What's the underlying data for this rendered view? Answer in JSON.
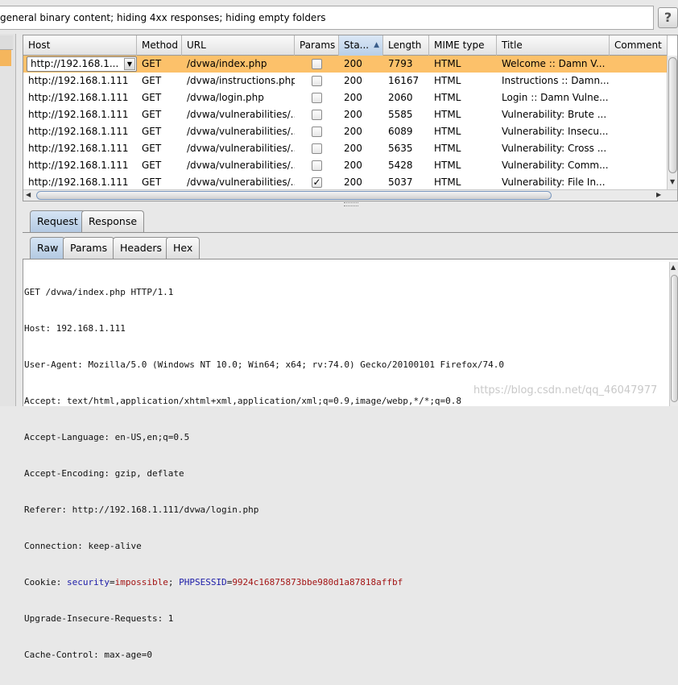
{
  "filter": {
    "text": "general binary content;  hiding 4xx responses;  hiding empty folders",
    "help_label": "?"
  },
  "table": {
    "columns": [
      "Host",
      "Method",
      "URL",
      "Params",
      "Sta...",
      "Length",
      "MIME type",
      "Title",
      "Comment"
    ],
    "sort_indicator": "▲",
    "rows": [
      {
        "host": "http://192.168.1...",
        "method": "GET",
        "url": "/dvwa/index.php",
        "params": false,
        "status": "200",
        "length": "7793",
        "mime": "HTML",
        "title": "Welcome :: Damn V...",
        "comment": "",
        "selected": true
      },
      {
        "host": "http://192.168.1.111",
        "method": "GET",
        "url": "/dvwa/instructions.php",
        "params": false,
        "status": "200",
        "length": "16167",
        "mime": "HTML",
        "title": "Instructions :: Damn...",
        "comment": "",
        "selected": false
      },
      {
        "host": "http://192.168.1.111",
        "method": "GET",
        "url": "/dvwa/login.php",
        "params": false,
        "status": "200",
        "length": "2060",
        "mime": "HTML",
        "title": "Login :: Damn Vulne...",
        "comment": "",
        "selected": false
      },
      {
        "host": "http://192.168.1.111",
        "method": "GET",
        "url": "/dvwa/vulnerabilities/...",
        "params": false,
        "status": "200",
        "length": "5585",
        "mime": "HTML",
        "title": "Vulnerability: Brute ...",
        "comment": "",
        "selected": false
      },
      {
        "host": "http://192.168.1.111",
        "method": "GET",
        "url": "/dvwa/vulnerabilities/...",
        "params": false,
        "status": "200",
        "length": "6089",
        "mime": "HTML",
        "title": "Vulnerability: Insecu...",
        "comment": "",
        "selected": false
      },
      {
        "host": "http://192.168.1.111",
        "method": "GET",
        "url": "/dvwa/vulnerabilities/...",
        "params": false,
        "status": "200",
        "length": "5635",
        "mime": "HTML",
        "title": "Vulnerability: Cross ...",
        "comment": "",
        "selected": false
      },
      {
        "host": "http://192.168.1.111",
        "method": "GET",
        "url": "/dvwa/vulnerabilities/...",
        "params": false,
        "status": "200",
        "length": "5428",
        "mime": "HTML",
        "title": "Vulnerability: Comm...",
        "comment": "",
        "selected": false
      },
      {
        "host": "http://192.168.1.111",
        "method": "GET",
        "url": "/dvwa/vulnerabilities/...",
        "params": true,
        "status": "200",
        "length": "5037",
        "mime": "HTML",
        "title": "Vulnerability: File In...",
        "comment": "",
        "selected": false
      }
    ]
  },
  "message_tabs": {
    "request": "Request",
    "response": "Response",
    "active": "request"
  },
  "view_tabs": {
    "raw": "Raw",
    "params": "Params",
    "headers": "Headers",
    "hex": "Hex",
    "active": "raw"
  },
  "request": {
    "lines": [
      "GET /dvwa/index.php HTTP/1.1",
      "Host: 192.168.1.111",
      "User-Agent: Mozilla/5.0 (Windows NT 10.0; Win64; x64; rv:74.0) Gecko/20100101 Firefox/74.0",
      "Accept: text/html,application/xhtml+xml,application/xml;q=0.9,image/webp,*/*;q=0.8",
      "Accept-Language: en-US,en;q=0.5",
      "Accept-Encoding: gzip, deflate",
      "Referer: http://192.168.1.111/dvwa/login.php",
      "Connection: keep-alive"
    ],
    "cookie_prefix": "Cookie: ",
    "cookies": [
      {
        "name": "security",
        "value": "impossible"
      },
      {
        "name": "PHPSESSID",
        "value": "9924c16875873bbe980d1a87818affbf"
      }
    ],
    "tail_lines": [
      "Upgrade-Insecure-Requests: 1",
      "Cache-Control: max-age=0"
    ]
  },
  "watermark": "https://blog.csdn.net/qq_46047977",
  "colors": {
    "selected_row": "#fcc16a",
    "tab_active": "#c3d6ec",
    "cookie_name": "#1c1ca8",
    "cookie_value": "#a31515"
  }
}
